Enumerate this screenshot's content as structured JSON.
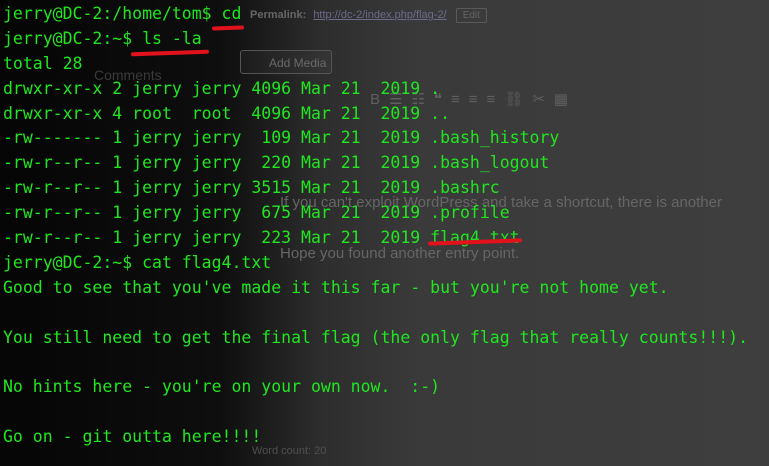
{
  "wp": {
    "permalink_label": "Permalink:",
    "permalink_url": "http://dc-2/index.php/flag-2/",
    "permalink_edit": "Edit",
    "add_media": "Add Media",
    "comments": "Comments",
    "content_line1": "If you can't exploit WordPress and take a shortcut, there is another",
    "content_line2": "Hope you found another entry point.",
    "word_count": "Word count: 20"
  },
  "terminal": {
    "lines": [
      "jerry@DC-2:/home/tom$ cd",
      "jerry@DC-2:~$ ls -la",
      "total 28",
      "drwxr-xr-x 2 jerry jerry 4096 Mar 21  2019 .",
      "drwxr-xr-x 4 root  root  4096 Mar 21  2019 ..",
      "-rw------- 1 jerry jerry  109 Mar 21  2019 .bash_history",
      "-rw-r--r-- 1 jerry jerry  220 Mar 21  2019 .bash_logout",
      "-rw-r--r-- 1 jerry jerry 3515 Mar 21  2019 .bashrc",
      "-rw-r--r-- 1 jerry jerry  675 Mar 21  2019 .profile",
      "-rw-r--r-- 1 jerry jerry  223 Mar 21  2019 flag4.txt",
      "jerry@DC-2:~$ cat flag4.txt",
      "Good to see that you've made it this far - but you're not home yet.",
      "",
      "You still need to get the final flag (the only flag that really counts!!!).",
      "",
      "No hints here - you're on your own now.  :-)",
      "",
      "Go on - git outta here!!!!"
    ]
  },
  "colors": {
    "terminal_text": "#20e620",
    "highlight": "#e1121c"
  }
}
